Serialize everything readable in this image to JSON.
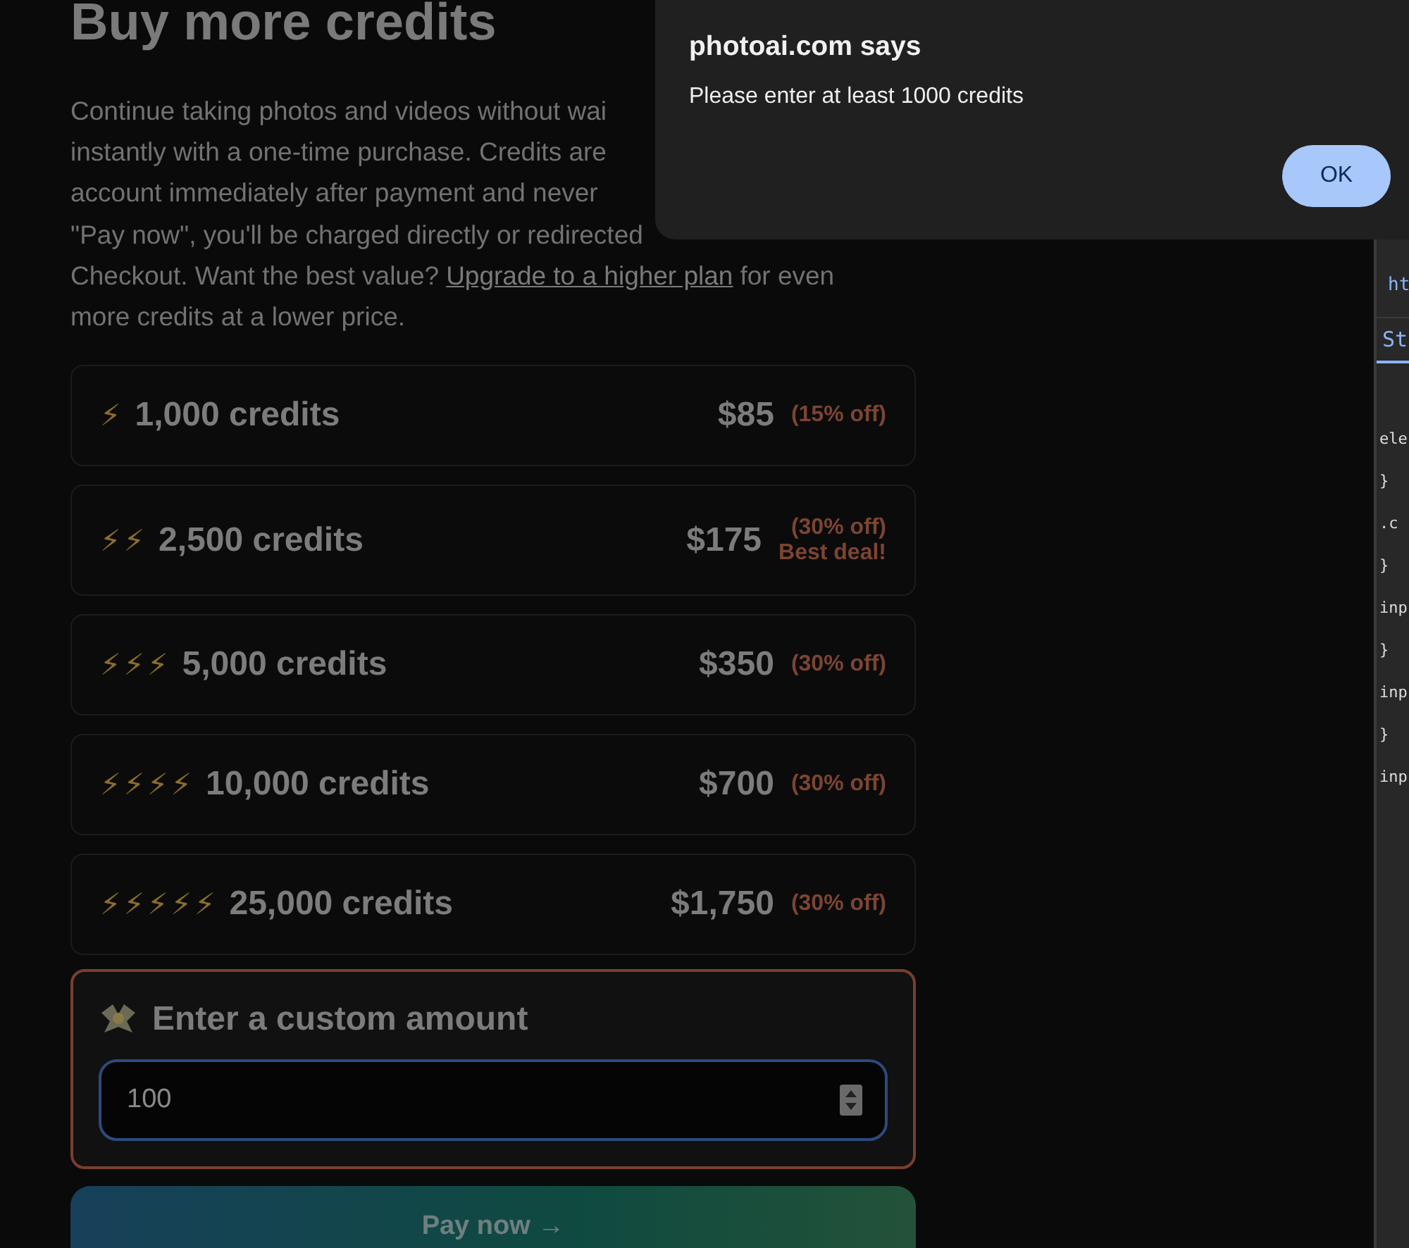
{
  "heading": "Buy more credits",
  "intro": {
    "lines": [
      "Continue taking photos and videos without wai",
      "instantly with a one-time purchase. Credits are",
      "account immediately after payment and never",
      "\"Pay now\", you'll be charged directly or redirected"
    ],
    "last_before": "Checkout. Want the best value?",
    "link": "Upgrade to a higher plan",
    "last_after": "for even",
    "final_line": "more credits at a lower price."
  },
  "packages": [
    {
      "bolts": "⚡",
      "credits": "1,000 credits",
      "price": "$85",
      "discount": "(15% off)"
    },
    {
      "bolts": "⚡⚡",
      "credits": "2,500 credits",
      "price": "$175",
      "discount": "(30% off)",
      "note": "Best deal!"
    },
    {
      "bolts": "⚡⚡⚡",
      "credits": "5,000 credits",
      "price": "$350",
      "discount": "(30% off)"
    },
    {
      "bolts": "⚡⚡⚡⚡",
      "credits": "10,000 credits",
      "price": "$700",
      "discount": "(30% off)"
    },
    {
      "bolts": "⚡⚡⚡⚡⚡",
      "credits": "25,000 credits",
      "price": "$1,750",
      "discount": "(30% off)"
    }
  ],
  "custom": {
    "title": "Enter a custom amount",
    "value": "100"
  },
  "pay_button": "Pay now →",
  "dialog": {
    "title": "photoai.com says",
    "message": "Please enter at least 1000 credits",
    "button": "OK"
  },
  "devtools": {
    "tab_top": "ht",
    "tab": "St",
    "lines": [
      "ele",
      "}",
      ".c",
      "}",
      "inp",
      "}",
      "inp",
      "}",
      "inp"
    ]
  }
}
